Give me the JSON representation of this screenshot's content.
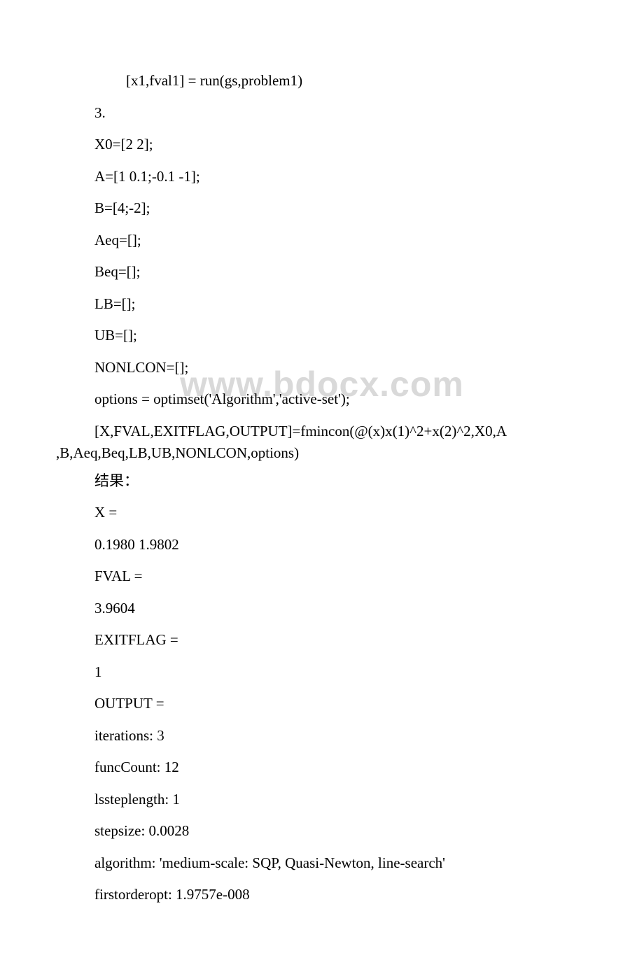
{
  "watermark": "www.bdocx.com",
  "lines": {
    "l1": "[x1,fval1] = run(gs,problem1)",
    "l2": "3.",
    "l3": "X0=[2 2];",
    "l4": "A=[1 0.1;-0.1 -1];",
    "l5": "B=[4;-2];",
    "l6": "Aeq=[];",
    "l7": "Beq=[];",
    "l8": "LB=[];",
    "l9": "UB=[];",
    "l10": "NONLCON=[];",
    "l11": "options = optimset('Algorithm','active-set');",
    "l12a": "[X,FVAL,EXITFLAG,OUTPUT]=fmincon(@(x)x(1)^2+x(2)^2,X0,A",
    "l12b": ",B,Aeq,Beq,LB,UB,NONLCON,options)",
    "l13": "结果：",
    "l14": "X =",
    "l15": " 0.1980 1.9802",
    "l16": "FVAL =",
    "l17": " 3.9604",
    "l18": "EXITFLAG =",
    "l19": " 1",
    "l20": "OUTPUT =",
    "l21": " iterations: 3",
    "l22": " funcCount: 12",
    "l23": " lssteplength: 1",
    "l24": " stepsize: 0.0028",
    "l25": " algorithm: 'medium-scale: SQP, Quasi-Newton, line-search'",
    "l26": " firstorderopt: 1.9757e-008"
  }
}
